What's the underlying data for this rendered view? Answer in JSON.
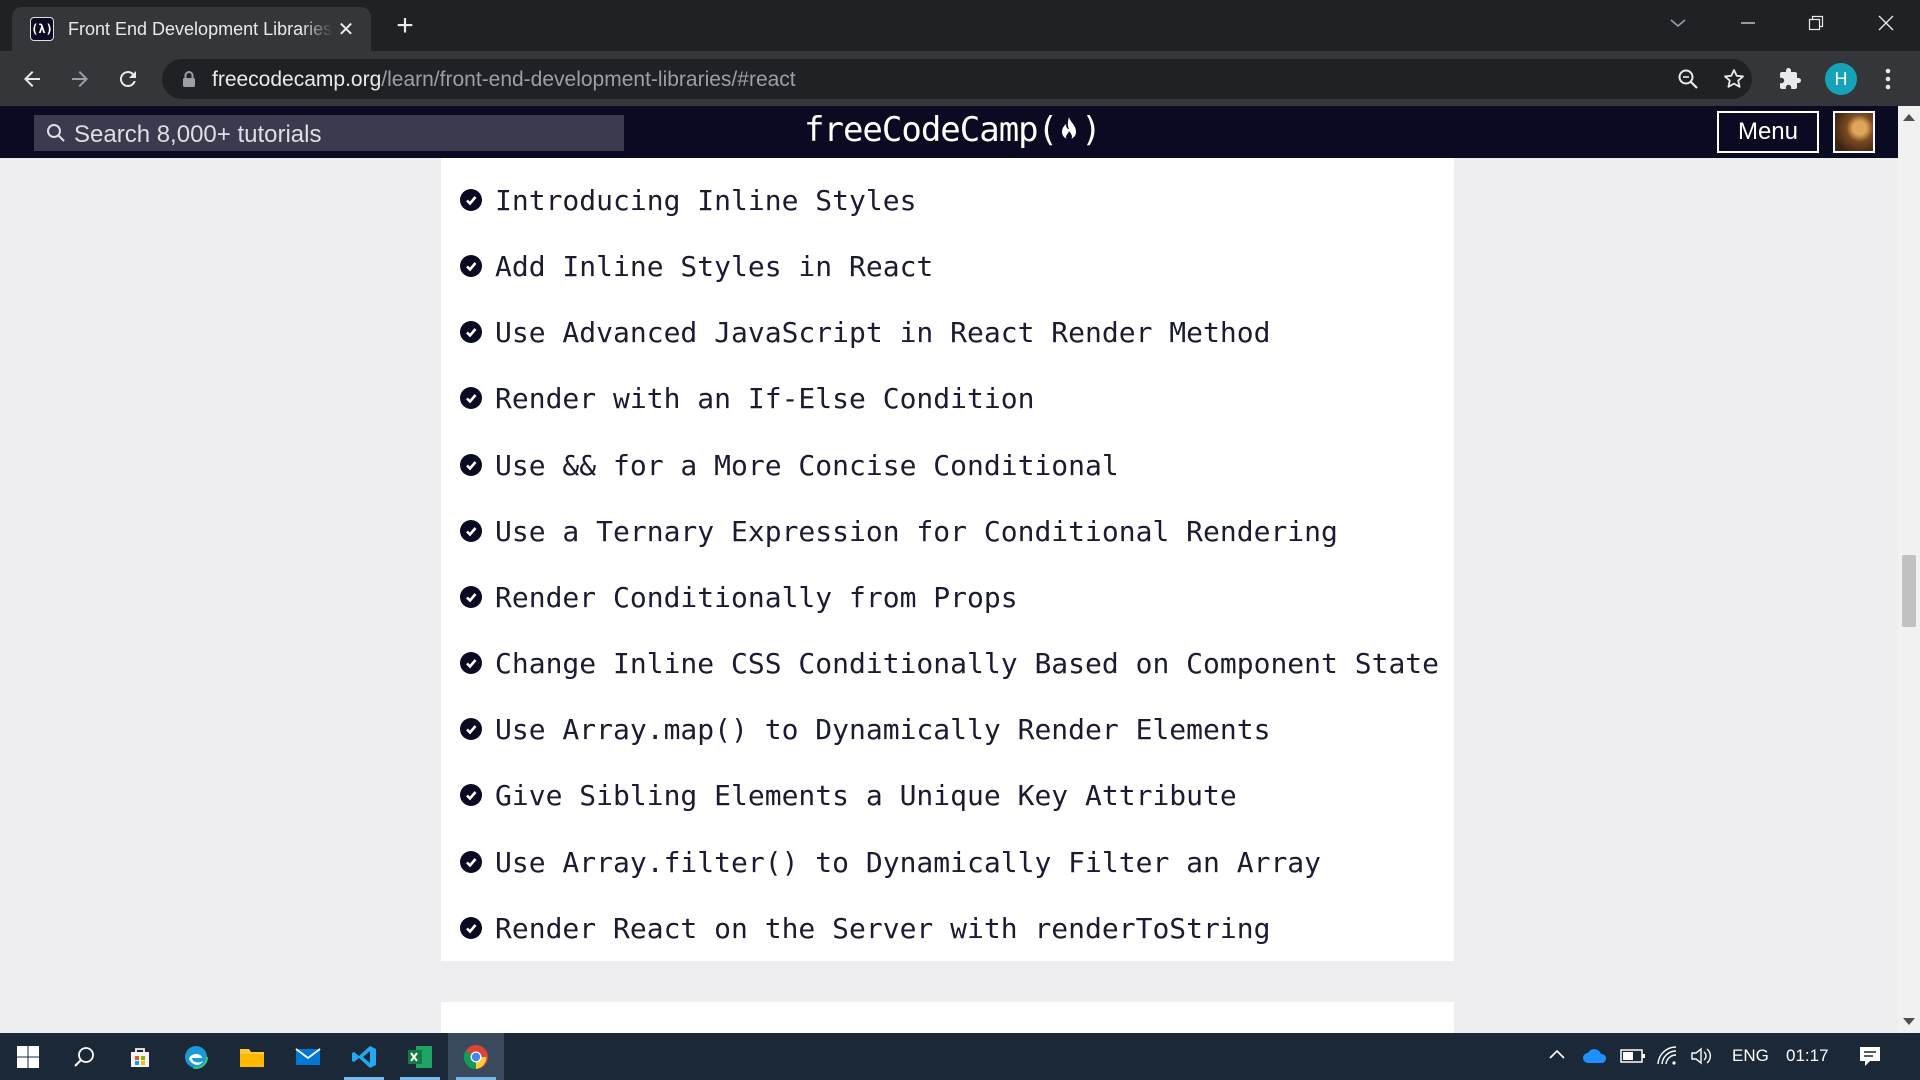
{
  "browser": {
    "tab_title": "Front End Development Libraries",
    "favicon_text": "(λ)",
    "url_host": "freecodecamp.org",
    "url_path": "/learn/front-end-development-libraries/#react",
    "profile_initial": "H"
  },
  "nav": {
    "search_placeholder": "Search 8,000+ tutorials",
    "logo": "freeCodeCamp(🔥)",
    "logo_text": "freeCodeCamp(",
    "logo_end": ")",
    "menu_label": "Menu"
  },
  "challenges": [
    {
      "label": "Introducing Inline Styles",
      "completed": true
    },
    {
      "label": "Add Inline Styles in React",
      "completed": true
    },
    {
      "label": "Use Advanced JavaScript in React Render Method",
      "completed": true
    },
    {
      "label": "Render with an If-Else Condition",
      "completed": true
    },
    {
      "label": "Use && for a More Concise Conditional",
      "completed": true
    },
    {
      "label": "Use a Ternary Expression for Conditional Rendering",
      "completed": true
    },
    {
      "label": "Render Conditionally from Props",
      "completed": true
    },
    {
      "label": "Change Inline CSS Conditionally Based on Component State",
      "completed": true
    },
    {
      "label": "Use Array.map() to Dynamically Render Elements",
      "completed": true
    },
    {
      "label": "Give Sibling Elements a Unique Key Attribute",
      "completed": true
    },
    {
      "label": "Use Array.filter() to Dynamically Filter an Array",
      "completed": true
    },
    {
      "label": "Render React on the Server with renderToString",
      "completed": true
    }
  ],
  "taskbar": {
    "language": "ENG",
    "time": "01:17",
    "apps": [
      "start-icon",
      "search-icon",
      "store-icon",
      "edge-icon",
      "file-explorer-icon",
      "mail-icon",
      "vscode-icon",
      "excel-icon",
      "chrome-icon"
    ]
  },
  "colors": {
    "fcc_nav": "#0a0a23",
    "chrome_dark": "#202124",
    "chrome_toolbar": "#35363a",
    "page_bg": "#eeeef0",
    "taskbar": "#1b2838"
  }
}
